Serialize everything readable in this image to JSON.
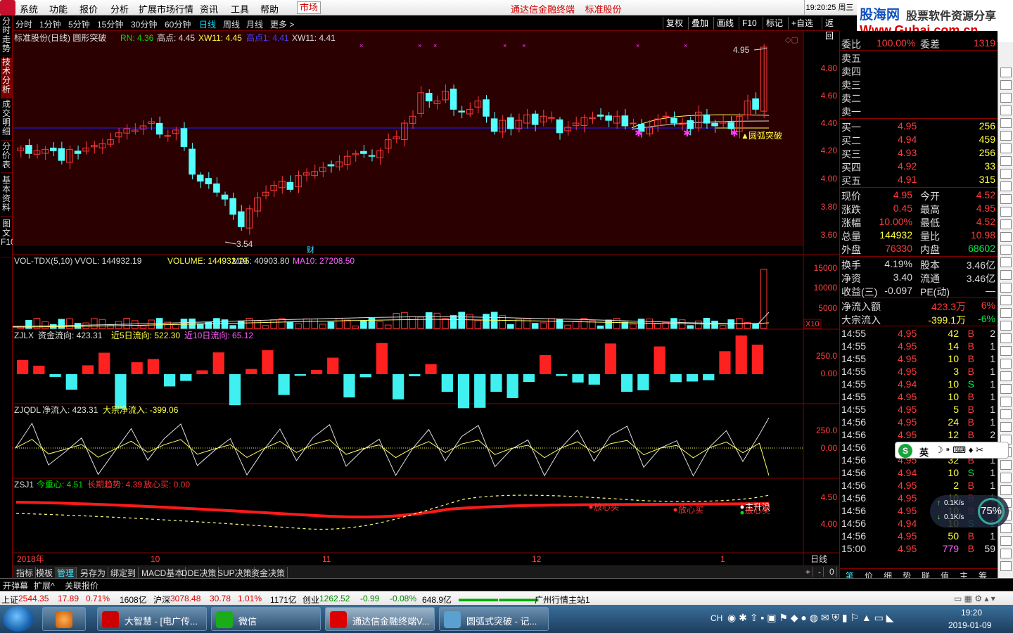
{
  "menu": [
    "系统",
    "功能",
    "报价",
    "分析",
    "扩展市场行情",
    "资讯",
    "工具",
    "帮助"
  ],
  "market_tab": "市场",
  "app_title": "通达信金融终端    标准股份",
  "clock": {
    "time": "19:20:25",
    "day": "周三"
  },
  "banner": {
    "brand": "股海网",
    "slogan": "股票软件资源分享",
    "url": "Www.Guhai.com.cn"
  },
  "side_tabs": [
    "分时走势",
    "技术分析",
    "成交明细",
    "分价表",
    "基本资料",
    "图文F10"
  ],
  "toolbar": {
    "periods": [
      "分时",
      "1分钟",
      "5分钟",
      "15分钟",
      "30分钟",
      "60分钟",
      "日线",
      "周线",
      "月线",
      "更多 >"
    ],
    "active_period": "日线",
    "buttons": [
      "复权",
      "叠加",
      "画线",
      "F10",
      "标记",
      "+自选",
      "返回"
    ]
  },
  "main_legend": {
    "name": "标准股份(日线) 圆形突破",
    "rn": "RN: 4.36",
    "gd": "高点: 4.45",
    "xw": "XW11: 4.45",
    "gd2": "高点1: 4.41",
    "xw2": "XW11: 4.41"
  },
  "main_axis": [
    "4.80",
    "4.60",
    "4.40",
    "4.20",
    "4.00",
    "3.80",
    "3.60"
  ],
  "main_labels": {
    "high": "4.95",
    "low": "3.54",
    "caption": "圆弧突破",
    "fin": "财"
  },
  "vol_legend": {
    "name": "VOL-TDX(5,10)",
    "vvol": "VVOL: 144932.19",
    "volume": "VOLUME: 144932.19",
    "ma5": "MA5: 40903.80",
    "ma10": "MA10: 27208.50"
  },
  "vol_axis": [
    "15000",
    "10000",
    "5000"
  ],
  "vol_unit": "X10",
  "zjlx_legend": {
    "name": "ZJLX",
    "a": "资金流向: 423.31",
    "b": "近5日流向: 522.30",
    "c": "近10日流向: 65.12"
  },
  "zjlx_axis": [
    "250.0",
    "0.00"
  ],
  "zjqdl_legend": {
    "name": "ZJQDL",
    "a": "净流入: 423.31",
    "b": "大宗净流入: -399.06"
  },
  "zjqdl_axis": [
    "250.0",
    "0.00"
  ],
  "zsj_legend": {
    "name": "ZSJ1",
    "a": "今重心: 4.51",
    "b": "长期趋势: 4.39",
    "c": "放心买: 0.00"
  },
  "zsj_axis": [
    "4.50",
    "4.00"
  ],
  "zsj_labels": [
    "放心买",
    "放心买",
    "主升浪",
    "放心买"
  ],
  "x_axis": [
    "2018年",
    "10",
    "11",
    "12",
    "1"
  ],
  "x_period": "日线",
  "bottom_tabs": [
    "指标",
    "模板",
    "管理",
    "另存为",
    "绑定到",
    "MACD基本",
    "DDE决策",
    "SUP决策",
    "资金决策"
  ],
  "active_bottom_tab": "管理",
  "bottom_right": [
    "+",
    "-",
    "0"
  ],
  "sub_tabs": [
    "开弹幕",
    "扩展^",
    "关联报价"
  ],
  "quote": {
    "wb": [
      "委比",
      "100.00%",
      "委差",
      "1319"
    ],
    "sell": [
      [
        "卖五",
        ""
      ],
      [
        "卖四",
        ""
      ],
      [
        "卖三",
        ""
      ],
      [
        "卖二",
        ""
      ],
      [
        "卖一",
        ""
      ]
    ],
    "buy": [
      [
        "买一",
        "4.95",
        "256"
      ],
      [
        "买二",
        "4.94",
        "459"
      ],
      [
        "买三",
        "4.93",
        "256"
      ],
      [
        "买四",
        "4.92",
        "33"
      ],
      [
        "买五",
        "4.91",
        "315"
      ]
    ],
    "stats": [
      [
        "现价",
        "4.95",
        "今开",
        "4.52"
      ],
      [
        "涨跌",
        "0.45",
        "最高",
        "4.95"
      ],
      [
        "涨幅",
        "10.00%",
        "最低",
        "4.52"
      ],
      [
        "总量",
        "144932",
        "量比",
        "10.98"
      ],
      [
        "外盘",
        "76330",
        "内盘",
        "68602"
      ]
    ],
    "stats2": [
      [
        "换手",
        "4.19%",
        "股本",
        "3.46亿"
      ],
      [
        "净资",
        "3.40",
        "流通",
        "3.46亿"
      ],
      [
        "收益(三)",
        "-0.097",
        "PE(动)",
        "—"
      ]
    ],
    "flow": [
      [
        "净流入额",
        "423.3万",
        "6%"
      ],
      [
        "大宗流入",
        "-399.1万",
        "-6%"
      ]
    ],
    "ticks": [
      [
        "14:55",
        "4.95",
        "42",
        "B",
        "2"
      ],
      [
        "14:55",
        "4.95",
        "14",
        "B",
        "1"
      ],
      [
        "14:55",
        "4.95",
        "10",
        "B",
        "1"
      ],
      [
        "14:55",
        "4.95",
        "3",
        "B",
        "1"
      ],
      [
        "14:55",
        "4.94",
        "10",
        "S",
        "1"
      ],
      [
        "14:55",
        "4.95",
        "10",
        "B",
        "1"
      ],
      [
        "14:55",
        "4.95",
        "5",
        "B",
        "1"
      ],
      [
        "14:56",
        "4.95",
        "24",
        "B",
        "1"
      ],
      [
        "14:56",
        "4.95",
        "12",
        "B",
        "2"
      ],
      [
        "14:56",
        "4.95",
        "5",
        "B",
        "1"
      ],
      [
        "14:56",
        "4.95",
        "32",
        "B",
        "1"
      ],
      [
        "14:56",
        "4.94",
        "10",
        "S",
        "1"
      ],
      [
        "14:56",
        "4.95",
        "2",
        "B",
        "1"
      ],
      [
        "14:56",
        "4.95",
        "10",
        "B",
        "1"
      ],
      [
        "14:56",
        "4.95",
        "10",
        "B",
        "1"
      ],
      [
        "14:56",
        "4.94",
        "10",
        "S",
        "1"
      ],
      [
        "14:56",
        "4.95",
        "50",
        "B",
        "1"
      ],
      [
        "15:00",
        "4.95",
        "779",
        "B",
        "59"
      ]
    ],
    "bottom_tabs": [
      "笔",
      "价",
      "细",
      "势",
      "联",
      "值",
      "主",
      "筹"
    ]
  },
  "status": {
    "sh": "上证",
    "sh_val": "2544.35",
    "sh_chg": "17.89",
    "sh_pct": "0.71%",
    "sh_amt": "1608亿",
    "hs": "沪深",
    "hs_val": "3078.48",
    "hs_chg": "30.78",
    "hs_pct": "1.01%",
    "hs_amt": "1171亿",
    "cy": "创业",
    "cy_val": "1262.52",
    "cy_chg": "-0.99",
    "cy_pct": "-0.08%",
    "cy_amt": "648.9亿",
    "server": "广州行情主站1"
  },
  "ime": {
    "lang": "英"
  },
  "net": {
    "up": "0.1K/s",
    "down": "0.1K/s",
    "pct": "75%"
  },
  "taskbar": {
    "tasks": [
      "大智慧 - [电广传...",
      "微信",
      "通达信金融终端V...",
      "圆弧式突破 - 记..."
    ],
    "active": 2,
    "tray_lang": "CH",
    "time": "19:20",
    "date": "2019-01-09"
  },
  "colors": {
    "up": "#ff3a3a",
    "down": "#54ffff",
    "bg_main": "#2a0000",
    "ma_line": "#2020ff"
  }
}
